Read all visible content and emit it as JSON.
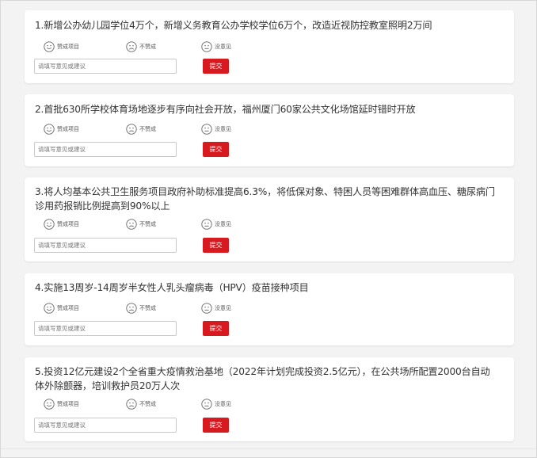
{
  "colors": {
    "accent": "#d71a1f",
    "card_bg": "#ffffff",
    "page_bg": "#f3f3f3"
  },
  "options": {
    "agree": "赞成项目",
    "disagree": "不赞成",
    "none": "没意见"
  },
  "icons": {
    "agree": "smile-face-icon",
    "disagree": "frown-face-icon",
    "none": "neutral-face-icon"
  },
  "input": {
    "placeholder": "请填写意见或建议"
  },
  "submit_label": "提交",
  "items": [
    {
      "title": "1.新增公办幼儿园学位4万个，新增义务教育公办学校学位6万个，改造近视防控教室照明2万间"
    },
    {
      "title": "2.首批630所学校体育场地逐步有序向社会开放，福州厦门60家公共文化场馆延时错时开放"
    },
    {
      "title": "3.将人均基本公共卫生服务项目政府补助标准提高6.3%，将低保对象、特困人员等困难群体高血压、糖尿病门诊用药报销比例提高到90%以上"
    },
    {
      "title": "4.实施13周岁-14周岁半女性人乳头瘤病毒（HPV）疫苗接种项目"
    },
    {
      "title": "5.投资12亿元建设2个全省重大疫情救治基地（2022年计划完成投资2.5亿元），在公共场所配置2000台自动体外除颤器，培训救护员20万人次"
    }
  ]
}
